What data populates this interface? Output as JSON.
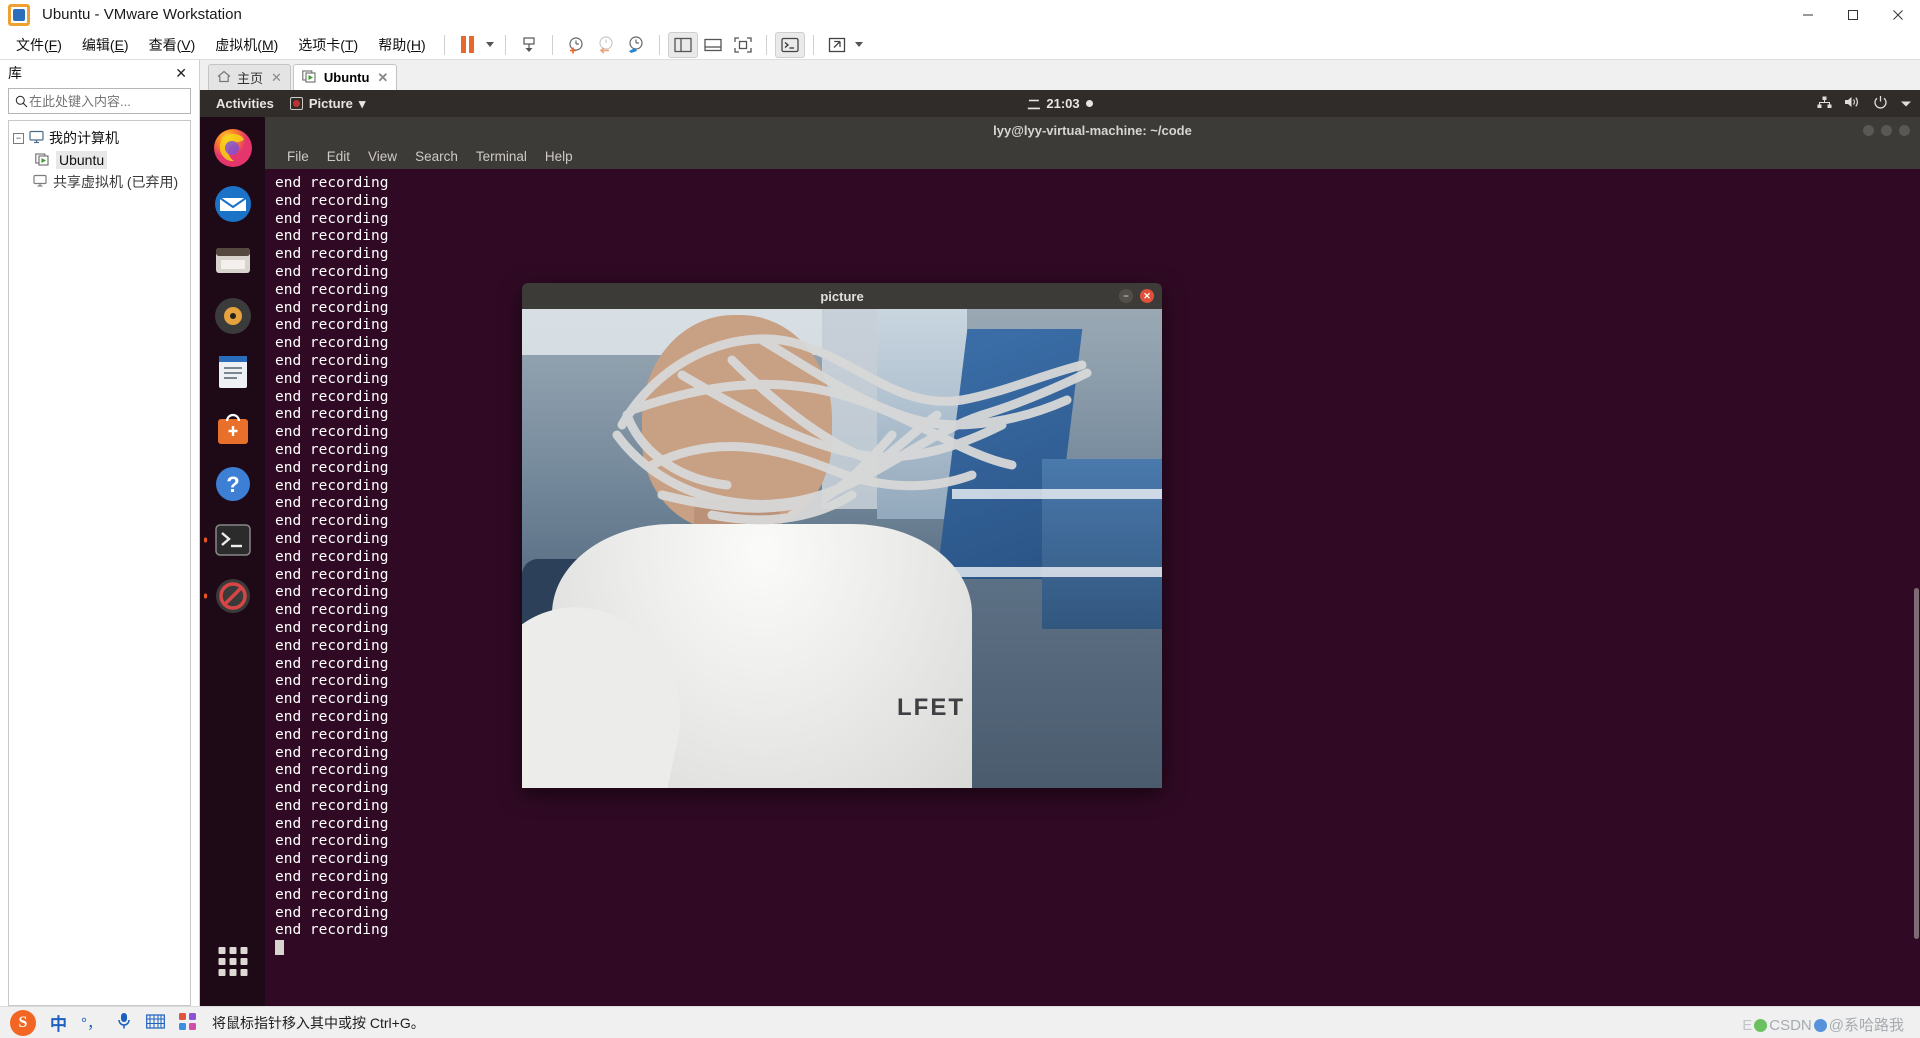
{
  "window": {
    "title": "Ubuntu - VMware Workstation",
    "controls": {
      "minimize": "minimize-icon",
      "maximize": "maximize-icon",
      "close": "close-icon"
    }
  },
  "menubar": {
    "items": [
      {
        "label": "文件(F)",
        "text": "文件",
        "accel": "F"
      },
      {
        "label": "编辑(E)",
        "text": "编辑",
        "accel": "E"
      },
      {
        "label": "查看(V)",
        "text": "查看",
        "accel": "V"
      },
      {
        "label": "虚拟机(M)",
        "text": "虚拟机",
        "accel": "M"
      },
      {
        "label": "选项卡(T)",
        "text": "选项卡",
        "accel": "T"
      },
      {
        "label": "帮助(H)",
        "text": "帮助",
        "accel": "H"
      }
    ]
  },
  "toolbar": {
    "buttons": [
      {
        "name": "suspend-button",
        "icon": "pause-icon"
      },
      {
        "name": "power-dropdown",
        "icon": "chevron-down-icon"
      },
      {
        "name": "snapshot-manager-button",
        "icon": "snapshot-icon"
      },
      {
        "name": "take-snapshot-button",
        "icon": "clock-plus-icon"
      },
      {
        "name": "revert-snapshot-button",
        "icon": "clock-back-icon"
      },
      {
        "name": "manage-snapshots-button",
        "icon": "clock-wrench-icon"
      },
      {
        "name": "show-library-button",
        "icon": "sidebar-panel-icon"
      },
      {
        "name": "show-thumbnail-bar-button",
        "icon": "bottom-panel-icon"
      },
      {
        "name": "fullscreen-button",
        "icon": "fullscreen-icon"
      },
      {
        "name": "console-button",
        "icon": "terminal-icon"
      },
      {
        "name": "unity-button",
        "icon": "expand-arrows-icon"
      },
      {
        "name": "unity-dropdown",
        "icon": "chevron-down-icon"
      }
    ]
  },
  "library": {
    "title": "库",
    "close_label": "✕",
    "search": {
      "placeholder": "在此处键入内容...",
      "value": "",
      "icon": "search-icon",
      "dropdown_icon": "chevron-down-icon"
    },
    "tree": [
      {
        "label": "我的计算机",
        "level": 1,
        "icon": "computer-icon",
        "expander": "−",
        "selected": false
      },
      {
        "label": "Ubuntu",
        "level": 2,
        "icon": "vm-running-icon",
        "selected": true
      },
      {
        "label": "共享虚拟机 (已弃用)",
        "level": 1,
        "icon": "shared-vm-icon",
        "selected": false
      }
    ]
  },
  "tabs": [
    {
      "label": "主页",
      "icon": "home-icon",
      "active": false,
      "close": "✕"
    },
    {
      "label": "Ubuntu",
      "icon": "vm-running-icon",
      "active": true,
      "close": "✕"
    }
  ],
  "guest": {
    "topbar": {
      "activities": "Activities",
      "app_menu": "Picture",
      "app_menu_caret": "▾",
      "clock_day": "二",
      "clock_time": "21:03",
      "indicators": [
        "network-icon",
        "volume-icon",
        "power-icon",
        "chevron-down-icon"
      ]
    },
    "dock": [
      {
        "name": "firefox",
        "icon": "firefox-icon",
        "running": false
      },
      {
        "name": "thunderbird",
        "icon": "mail-icon",
        "running": false
      },
      {
        "name": "files",
        "icon": "files-icon",
        "running": false
      },
      {
        "name": "rhythmbox",
        "icon": "music-icon",
        "running": false
      },
      {
        "name": "libreoffice-writer",
        "icon": "document-icon",
        "running": false
      },
      {
        "name": "ubuntu-software",
        "icon": "software-bag-icon",
        "running": false
      },
      {
        "name": "help",
        "icon": "help-icon",
        "running": false
      },
      {
        "name": "terminal",
        "icon": "terminal-icon",
        "running": true
      },
      {
        "name": "trash-eject",
        "icon": "forbidden-icon",
        "running": true
      },
      {
        "name": "show-applications",
        "icon": "apps-grid-icon",
        "running": false
      }
    ],
    "terminal": {
      "title": "lyy@lyy-virtual-machine: ~/code",
      "menu": [
        "File",
        "Edit",
        "View",
        "Search",
        "Terminal",
        "Help"
      ],
      "window_buttons": [
        "minimize-icon",
        "maximize-icon",
        "close-icon"
      ],
      "line_text": "end recording",
      "line_count": 43,
      "prompt_cursor": "block-cursor"
    },
    "picture_window": {
      "title": "picture",
      "buttons": [
        "minimize-icon",
        "close-icon"
      ],
      "image_caption": "LFET",
      "image_description": "webcam-photo-person-face-obscured"
    }
  },
  "statusbar": {
    "ime": {
      "logo": "S",
      "mode": "中",
      "punctuation": "°，",
      "voice_icon": "microphone-icon",
      "keyboard_icon": "keyboard-icon",
      "apps_icon": "apps-grid-icon"
    },
    "hint": "将鼠标指针移入其中或按 Ctrl+G。",
    "watermark": "CSDN @系哈路我"
  },
  "colors": {
    "vmware_orange": "#e8682a",
    "ubuntu_purple": "#300a24",
    "ubuntu_orange": "#e95420",
    "gnome_bar": "#2f2c29",
    "terminal_chrome": "#3c3b37"
  }
}
